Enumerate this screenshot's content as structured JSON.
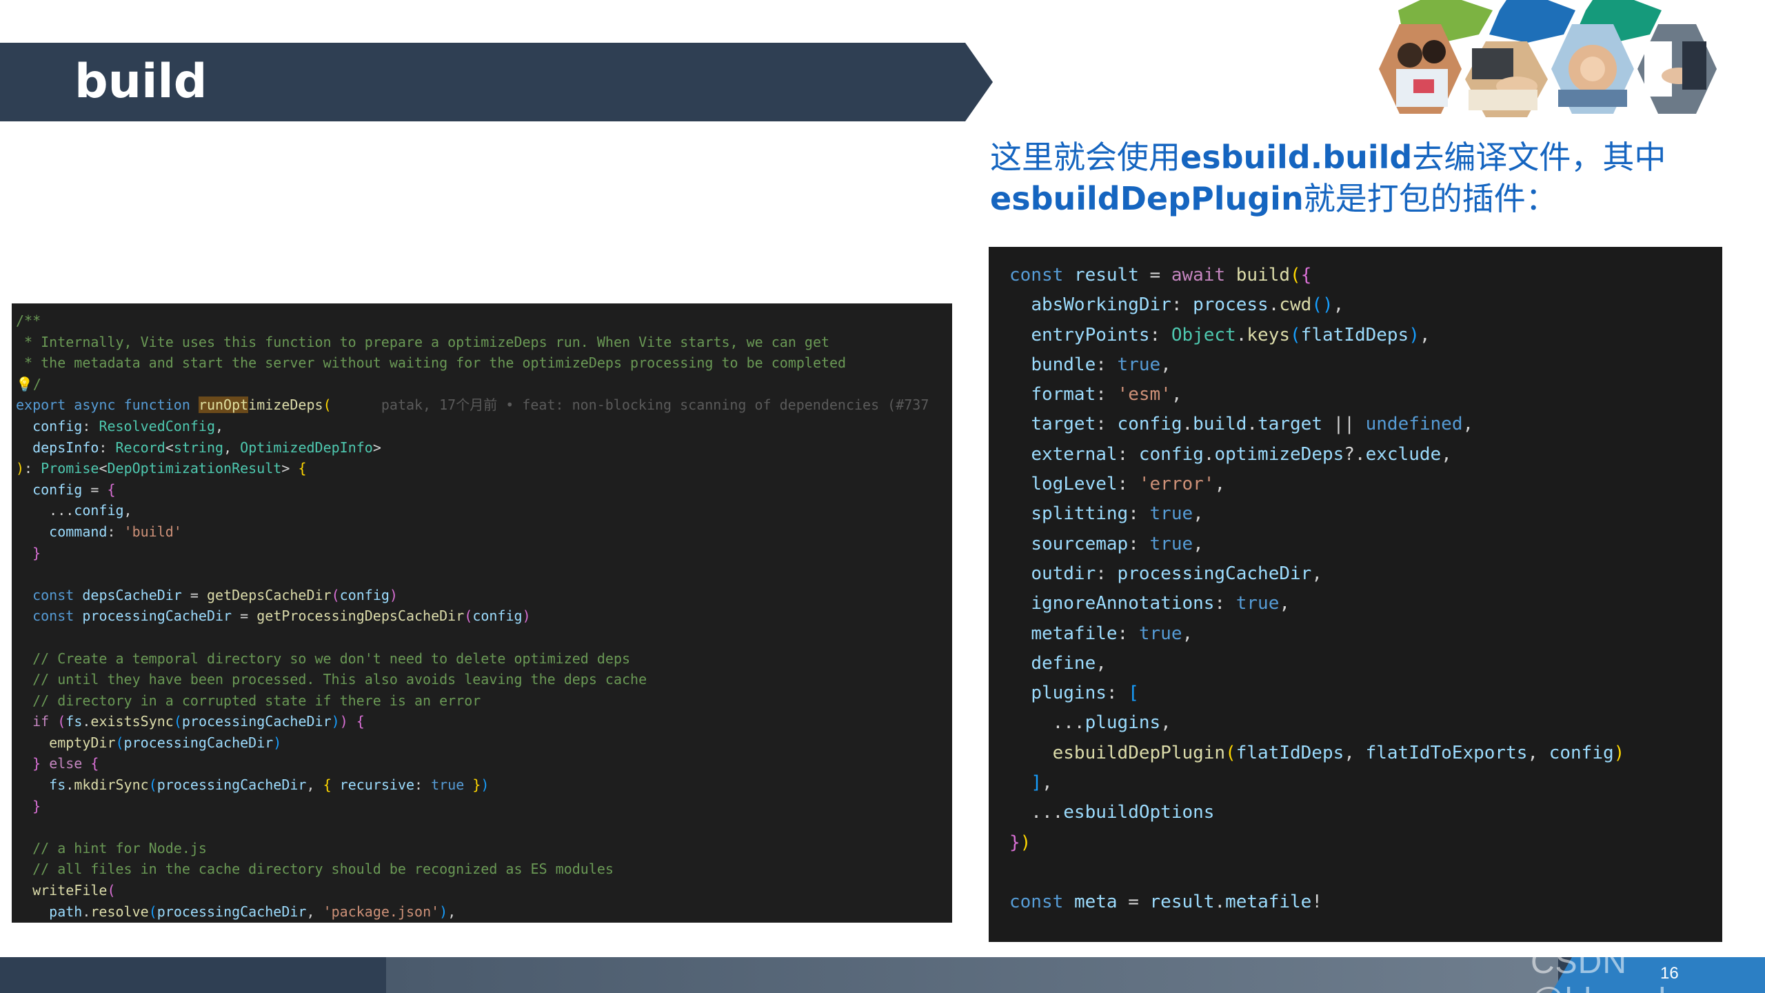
{
  "slide": {
    "title": "build",
    "page_number": "16",
    "watermark": "CSDN @bloxed",
    "description": {
      "part1": "这里就会使用",
      "kw1": "esbuild.build",
      "part2": "去编译文件，其中",
      "kw2": "esbuildDepPlugin",
      "part3": "就是打包的插件："
    }
  },
  "colors": {
    "title_bar": "#2f3f53",
    "description_text": "#1565c0",
    "code_background": "#1e1e1e",
    "hex_green": "#7cb342",
    "hex_blue": "#1e6fb8",
    "hex_teal": "#159a7b"
  },
  "hex_images": [
    "people-meeting",
    "business-handshake",
    "stacked-hands",
    "handshake-deal"
  ],
  "left_code": {
    "lines": [
      [
        [
          "c-cmt",
          "/**"
        ]
      ],
      [
        [
          "c-cmt",
          " * Internally, Vite uses this function to prepare a optimizeDeps run. When Vite starts, we can get"
        ]
      ],
      [
        [
          "c-cmt",
          " * the metadata and start the server without waiting for the optimizeDeps processing to be completed"
        ]
      ],
      [
        [
          "bulb",
          "💡"
        ],
        [
          "c-cmt",
          "/"
        ]
      ],
      [
        [
          "c-kw",
          "export"
        ],
        [
          "c-pun",
          " "
        ],
        [
          "c-kw",
          "async"
        ],
        [
          "c-pun",
          " "
        ],
        [
          "c-kw",
          "function"
        ],
        [
          "c-pun",
          " "
        ],
        [
          "hl",
          "runOpt"
        ],
        [
          "c-fn",
          "imizeDeps"
        ],
        [
          "c-br1",
          "("
        ],
        [
          "c-blame",
          "      patak, 17个月前 • feat: non-blocking scanning of dependencies (#737"
        ]
      ],
      [
        [
          "c-pun",
          "  "
        ],
        [
          "c-var",
          "config"
        ],
        [
          "c-pun",
          ": "
        ],
        [
          "c-type",
          "ResolvedConfig"
        ],
        [
          "c-pun",
          ","
        ]
      ],
      [
        [
          "c-pun",
          "  "
        ],
        [
          "c-var",
          "depsInfo"
        ],
        [
          "c-pun",
          ": "
        ],
        [
          "c-type",
          "Record"
        ],
        [
          "c-pun",
          "<"
        ],
        [
          "c-type",
          "string"
        ],
        [
          "c-pun",
          ", "
        ],
        [
          "c-type",
          "OptimizedDepInfo"
        ],
        [
          "c-pun",
          ">"
        ]
      ],
      [
        [
          "c-br1",
          ")"
        ],
        [
          "c-pun",
          ": "
        ],
        [
          "c-type",
          "Promise"
        ],
        [
          "c-pun",
          "<"
        ],
        [
          "c-type",
          "DepOptimizationResult"
        ],
        [
          "c-pun",
          "> "
        ],
        [
          "c-br1",
          "{"
        ]
      ],
      [
        [
          "c-pun",
          "  "
        ],
        [
          "c-var",
          "config"
        ],
        [
          "c-pun",
          " = "
        ],
        [
          "c-br2",
          "{"
        ]
      ],
      [
        [
          "c-pun",
          "    ..."
        ],
        [
          "c-var",
          "config"
        ],
        [
          "c-pun",
          ","
        ]
      ],
      [
        [
          "c-pun",
          "    "
        ],
        [
          "c-var",
          "command"
        ],
        [
          "c-pun",
          ": "
        ],
        [
          "c-str",
          "'build'"
        ]
      ],
      [
        [
          "c-pun",
          "  "
        ],
        [
          "c-br2",
          "}"
        ]
      ],
      [
        [
          "c-pun",
          ""
        ]
      ],
      [
        [
          "c-pun",
          "  "
        ],
        [
          "c-kw",
          "const"
        ],
        [
          "c-pun",
          " "
        ],
        [
          "c-var",
          "depsCacheDir"
        ],
        [
          "c-pun",
          " = "
        ],
        [
          "c-fn",
          "getDepsCacheDir"
        ],
        [
          "c-br2",
          "("
        ],
        [
          "c-var",
          "config"
        ],
        [
          "c-br2",
          ")"
        ]
      ],
      [
        [
          "c-pun",
          "  "
        ],
        [
          "c-kw",
          "const"
        ],
        [
          "c-pun",
          " "
        ],
        [
          "c-var",
          "processingCacheDir"
        ],
        [
          "c-pun",
          " = "
        ],
        [
          "c-fn",
          "getProcessingDepsCacheDir"
        ],
        [
          "c-br2",
          "("
        ],
        [
          "c-var",
          "config"
        ],
        [
          "c-br2",
          ")"
        ]
      ],
      [
        [
          "c-pun",
          ""
        ]
      ],
      [
        [
          "c-cmt",
          "  // Create a temporal directory so we don't need to delete optimized deps"
        ]
      ],
      [
        [
          "c-cmt",
          "  // until they have been processed. This also avoids leaving the deps cache"
        ]
      ],
      [
        [
          "c-cmt",
          "  // directory in a corrupted state if there is an error"
        ]
      ],
      [
        [
          "c-pun",
          "  "
        ],
        [
          "c-ctl",
          "if"
        ],
        [
          "c-pun",
          " "
        ],
        [
          "c-br2",
          "("
        ],
        [
          "c-var",
          "fs"
        ],
        [
          "c-pun",
          "."
        ],
        [
          "c-fn",
          "existsSync"
        ],
        [
          "c-br3",
          "("
        ],
        [
          "c-var",
          "processingCacheDir"
        ],
        [
          "c-br3",
          ")"
        ],
        [
          "c-br2",
          ")"
        ],
        [
          "c-pun",
          " "
        ],
        [
          "c-br2",
          "{"
        ]
      ],
      [
        [
          "c-pun",
          "    "
        ],
        [
          "c-fn",
          "emptyDir"
        ],
        [
          "c-br3",
          "("
        ],
        [
          "c-var",
          "processingCacheDir"
        ],
        [
          "c-br3",
          ")"
        ]
      ],
      [
        [
          "c-pun",
          "  "
        ],
        [
          "c-br2",
          "}"
        ],
        [
          "c-pun",
          " "
        ],
        [
          "c-ctl",
          "else"
        ],
        [
          "c-pun",
          " "
        ],
        [
          "c-br2",
          "{"
        ]
      ],
      [
        [
          "c-pun",
          "    "
        ],
        [
          "c-var",
          "fs"
        ],
        [
          "c-pun",
          "."
        ],
        [
          "c-fn",
          "mkdirSync"
        ],
        [
          "c-br3",
          "("
        ],
        [
          "c-var",
          "processingCacheDir"
        ],
        [
          "c-pun",
          ", "
        ],
        [
          "c-br1",
          "{"
        ],
        [
          "c-pun",
          " "
        ],
        [
          "c-var",
          "recursive"
        ],
        [
          "c-pun",
          ": "
        ],
        [
          "c-kw",
          "true"
        ],
        [
          "c-pun",
          " "
        ],
        [
          "c-br1",
          "}"
        ],
        [
          "c-br3",
          ")"
        ]
      ],
      [
        [
          "c-pun",
          "  "
        ],
        [
          "c-br2",
          "}"
        ]
      ],
      [
        [
          "c-pun",
          ""
        ]
      ],
      [
        [
          "c-cmt",
          "  // a hint for Node.js"
        ]
      ],
      [
        [
          "c-cmt",
          "  // all files in the cache directory should be recognized as ES modules"
        ]
      ],
      [
        [
          "c-pun",
          "  "
        ],
        [
          "c-fn",
          "writeFile"
        ],
        [
          "c-br2",
          "("
        ]
      ],
      [
        [
          "c-pun",
          "    "
        ],
        [
          "c-var",
          "path"
        ],
        [
          "c-pun",
          "."
        ],
        [
          "c-fn",
          "resolve"
        ],
        [
          "c-br3",
          "("
        ],
        [
          "c-var",
          "processingCacheDir"
        ],
        [
          "c-pun",
          ", "
        ],
        [
          "c-str",
          "'package.json'"
        ],
        [
          "c-br3",
          ")"
        ],
        [
          "c-pun",
          ","
        ]
      ]
    ]
  },
  "right_code": {
    "lines": [
      [
        [
          "c-kw",
          "const"
        ],
        [
          "c-pun",
          " "
        ],
        [
          "c-var",
          "result"
        ],
        [
          "c-pun",
          " = "
        ],
        [
          "c-ctl",
          "await"
        ],
        [
          "c-pun",
          " "
        ],
        [
          "c-fn",
          "build"
        ],
        [
          "c-br1",
          "("
        ],
        [
          "c-br2",
          "{"
        ]
      ],
      [
        [
          "c-pun",
          "  "
        ],
        [
          "c-var",
          "absWorkingDir"
        ],
        [
          "c-pun",
          ": "
        ],
        [
          "c-var",
          "process"
        ],
        [
          "c-pun",
          "."
        ],
        [
          "c-fn",
          "cwd"
        ],
        [
          "c-br3",
          "()"
        ],
        [
          "c-pun",
          ","
        ]
      ],
      [
        [
          "c-pun",
          "  "
        ],
        [
          "c-var",
          "entryPoints"
        ],
        [
          "c-pun",
          ": "
        ],
        [
          "c-type",
          "Object"
        ],
        [
          "c-pun",
          "."
        ],
        [
          "c-fn",
          "keys"
        ],
        [
          "c-br3",
          "("
        ],
        [
          "c-var",
          "flatIdDeps"
        ],
        [
          "c-br3",
          ")"
        ],
        [
          "c-pun",
          ","
        ]
      ],
      [
        [
          "c-pun",
          "  "
        ],
        [
          "c-var",
          "bundle"
        ],
        [
          "c-pun",
          ": "
        ],
        [
          "c-kw",
          "true"
        ],
        [
          "c-pun",
          ","
        ]
      ],
      [
        [
          "c-pun",
          "  "
        ],
        [
          "c-var",
          "format"
        ],
        [
          "c-pun",
          ": "
        ],
        [
          "c-str",
          "'esm'"
        ],
        [
          "c-pun",
          ","
        ]
      ],
      [
        [
          "c-pun",
          "  "
        ],
        [
          "c-var",
          "target"
        ],
        [
          "c-pun",
          ": "
        ],
        [
          "c-var",
          "config"
        ],
        [
          "c-pun",
          "."
        ],
        [
          "c-var",
          "build"
        ],
        [
          "c-pun",
          "."
        ],
        [
          "c-var",
          "target"
        ],
        [
          "c-pun",
          " || "
        ],
        [
          "c-kw",
          "undefined"
        ],
        [
          "c-pun",
          ","
        ]
      ],
      [
        [
          "c-pun",
          "  "
        ],
        [
          "c-var",
          "external"
        ],
        [
          "c-pun",
          ": "
        ],
        [
          "c-var",
          "config"
        ],
        [
          "c-pun",
          "."
        ],
        [
          "c-var",
          "optimizeDeps"
        ],
        [
          "c-pun",
          "?."
        ],
        [
          "c-var",
          "exclude"
        ],
        [
          "c-pun",
          ","
        ]
      ],
      [
        [
          "c-pun",
          "  "
        ],
        [
          "c-var",
          "logLevel"
        ],
        [
          "c-pun",
          ": "
        ],
        [
          "c-str",
          "'error'"
        ],
        [
          "c-pun",
          ","
        ]
      ],
      [
        [
          "c-pun",
          "  "
        ],
        [
          "c-var",
          "splitting"
        ],
        [
          "c-pun",
          ": "
        ],
        [
          "c-kw",
          "true"
        ],
        [
          "c-pun",
          ","
        ]
      ],
      [
        [
          "c-pun",
          "  "
        ],
        [
          "c-var",
          "sourcemap"
        ],
        [
          "c-pun",
          ": "
        ],
        [
          "c-kw",
          "true"
        ],
        [
          "c-pun",
          ","
        ]
      ],
      [
        [
          "c-pun",
          "  "
        ],
        [
          "c-var",
          "outdir"
        ],
        [
          "c-pun",
          ": "
        ],
        [
          "c-var",
          "processingCacheDir"
        ],
        [
          "c-pun",
          ","
        ]
      ],
      [
        [
          "c-pun",
          "  "
        ],
        [
          "c-var",
          "ignoreAnnotations"
        ],
        [
          "c-pun",
          ": "
        ],
        [
          "c-kw",
          "true"
        ],
        [
          "c-pun",
          ","
        ]
      ],
      [
        [
          "c-pun",
          "  "
        ],
        [
          "c-var",
          "metafile"
        ],
        [
          "c-pun",
          ": "
        ],
        [
          "c-kw",
          "true"
        ],
        [
          "c-pun",
          ","
        ]
      ],
      [
        [
          "c-pun",
          "  "
        ],
        [
          "c-var",
          "define"
        ],
        [
          "c-pun",
          ","
        ]
      ],
      [
        [
          "c-pun",
          "  "
        ],
        [
          "c-var",
          "plugins"
        ],
        [
          "c-pun",
          ": "
        ],
        [
          "c-br3",
          "["
        ]
      ],
      [
        [
          "c-pun",
          "    ..."
        ],
        [
          "c-var",
          "plugins"
        ],
        [
          "c-pun",
          ","
        ]
      ],
      [
        [
          "c-pun",
          "    "
        ],
        [
          "c-fn",
          "esbuildDepPlugin"
        ],
        [
          "c-br1",
          "("
        ],
        [
          "c-var",
          "flatIdDeps"
        ],
        [
          "c-pun",
          ", "
        ],
        [
          "c-var",
          "flatIdToExports"
        ],
        [
          "c-pun",
          ", "
        ],
        [
          "c-var",
          "config"
        ],
        [
          "c-br1",
          ")"
        ]
      ],
      [
        [
          "c-pun",
          "  "
        ],
        [
          "c-br3",
          "]"
        ],
        [
          "c-pun",
          ","
        ]
      ],
      [
        [
          "c-pun",
          "  ..."
        ],
        [
          "c-var",
          "esbuildOptions"
        ]
      ],
      [
        [
          "c-br2",
          "}"
        ],
        [
          "c-br1",
          ")"
        ]
      ],
      [
        [
          "c-pun",
          ""
        ]
      ],
      [
        [
          "c-kw",
          "const"
        ],
        [
          "c-pun",
          " "
        ],
        [
          "c-var",
          "meta"
        ],
        [
          "c-pun",
          " = "
        ],
        [
          "c-var",
          "result"
        ],
        [
          "c-pun",
          "."
        ],
        [
          "c-var",
          "metafile"
        ],
        [
          "c-pun",
          "!"
        ]
      ]
    ]
  }
}
